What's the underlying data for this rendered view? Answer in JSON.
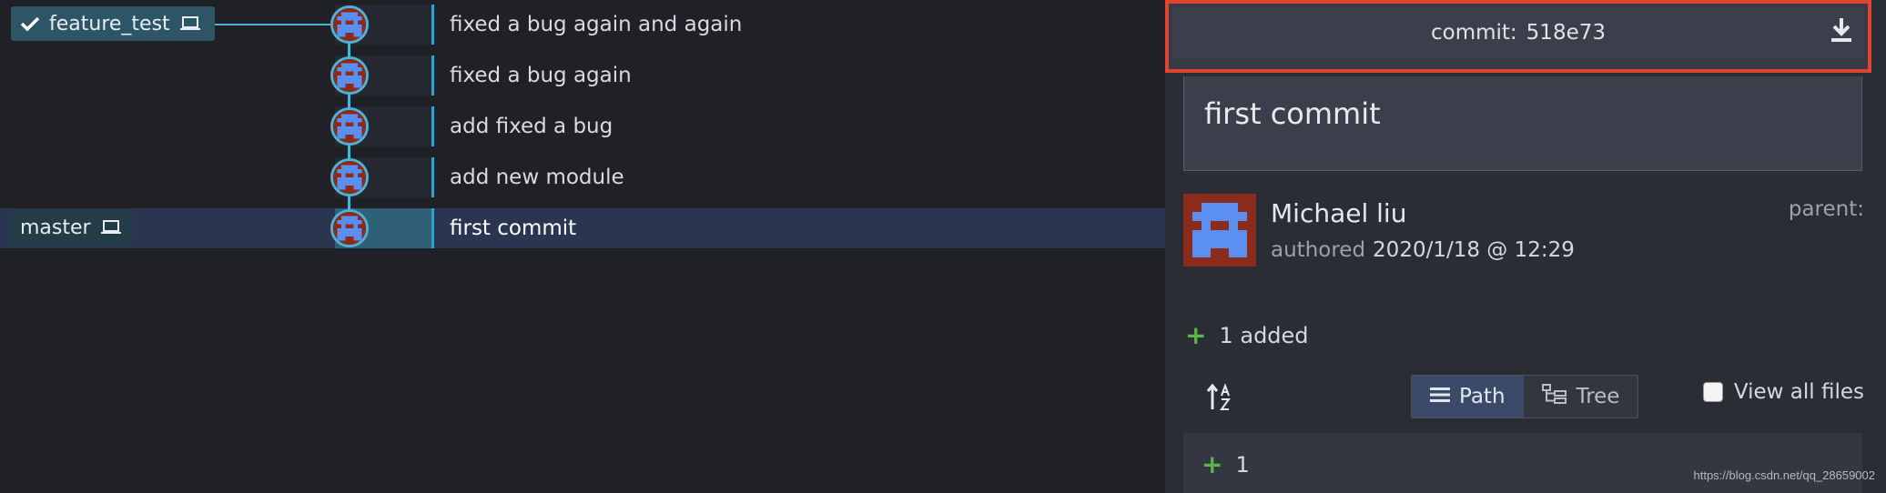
{
  "branches": [
    {
      "name": "feature_test",
      "checked": true,
      "icon": "laptop-icon"
    },
    {
      "name": "master",
      "checked": false,
      "icon": "laptop-icon"
    }
  ],
  "commits": [
    {
      "message": "fixed a bug again and again",
      "selected": false
    },
    {
      "message": "fixed a bug again",
      "selected": false
    },
    {
      "message": "add fixed a bug",
      "selected": false
    },
    {
      "message": "add new module",
      "selected": false
    },
    {
      "message": "first commit",
      "selected": true
    }
  ],
  "detail": {
    "commit_label": "commit:",
    "commit_sha": "518e73",
    "message": "first commit",
    "author": "Michael liu",
    "authored_label": "authored",
    "authored_date": "2020/1/18 @ 12:29",
    "parent_label": "parent:",
    "added_summary": "1 added",
    "view_path_label": "Path",
    "view_tree_label": "Tree",
    "view_all_files_label": "View all files",
    "file_count": "1"
  },
  "watermark": "https://blog.csdn.net/qq_28659002",
  "colors": {
    "accent_blue": "#4db2d6",
    "highlight_red": "#e04532",
    "added_green": "#5fb34a"
  }
}
